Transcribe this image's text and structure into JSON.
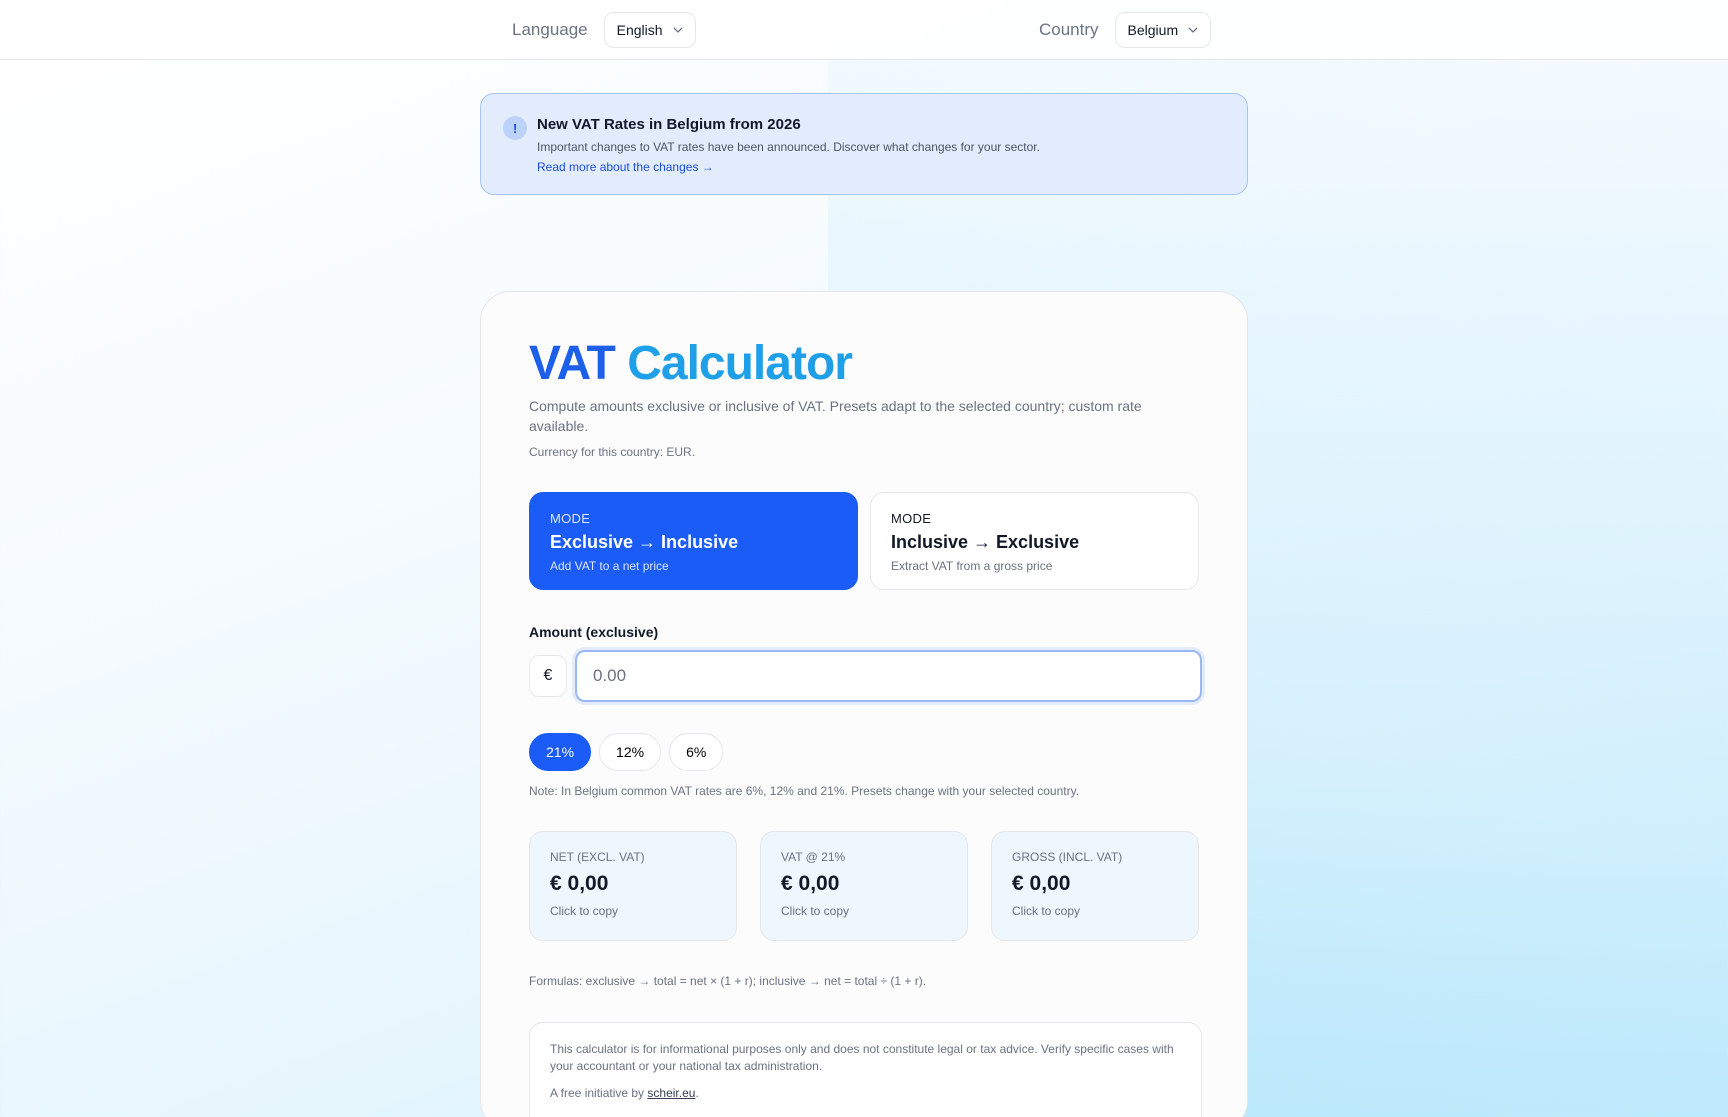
{
  "topbar": {
    "language_label": "Language",
    "language_value": "English",
    "country_label": "Country",
    "country_value": "Belgium"
  },
  "banner": {
    "icon": "exclamation-icon",
    "icon_glyph": "!",
    "title": "New VAT Rates in Belgium from 2026",
    "text": "Important changes to VAT rates have been announced. Discover what changes for your sector.",
    "link": "Read more about the changes →"
  },
  "calculator": {
    "title_part1": "VAT",
    "title_part2": "Calculator",
    "subtitle": "Compute amounts exclusive or inclusive of VAT. Presets adapt to the selected country; custom rate available.",
    "currency_note": "Currency for this country: EUR.",
    "modes": [
      {
        "kicker": "MODE",
        "title": "Exclusive → Inclusive",
        "desc": "Add VAT to a net price"
      },
      {
        "kicker": "MODE",
        "title": "Inclusive → Exclusive",
        "desc": "Extract VAT from a gross price"
      }
    ],
    "amount_label": "Amount (exclusive)",
    "currency_symbol": "€",
    "amount_placeholder": "0.00",
    "rates": [
      "21%",
      "12%",
      "6%"
    ],
    "selected_rate": "21%",
    "rate_note": "Note: In Belgium common VAT rates are 6%, 12% and 21%. Presets change with your selected country.",
    "results": [
      {
        "label": "NET (EXCL. VAT)",
        "value": "€ 0,00",
        "hint": "Click to copy"
      },
      {
        "label": "VAT @ 21%",
        "value": "€ 0,00",
        "hint": "Click to copy"
      },
      {
        "label": "GROSS (INCL. VAT)",
        "value": "€ 0,00",
        "hint": "Click to copy"
      }
    ],
    "formulas": "Formulas: exclusive → total = net × (1 + r); inclusive → net = total ÷ (1 + r).",
    "disclaimer": {
      "text": "This calculator is for informational purposes only and does not constitute legal or tax advice. Verify specific cases with your accountant or your national tax administration.",
      "initiative_prefix": "A free initiative by",
      "initiative_link": "scheir.eu",
      "initiative_suffix": "."
    }
  },
  "colors": {
    "accent": "#1a5cf5",
    "title_blue": "#1d5fe8",
    "title_cyan": "#1e9fe8",
    "banner_bg": "#e3ecfd"
  }
}
